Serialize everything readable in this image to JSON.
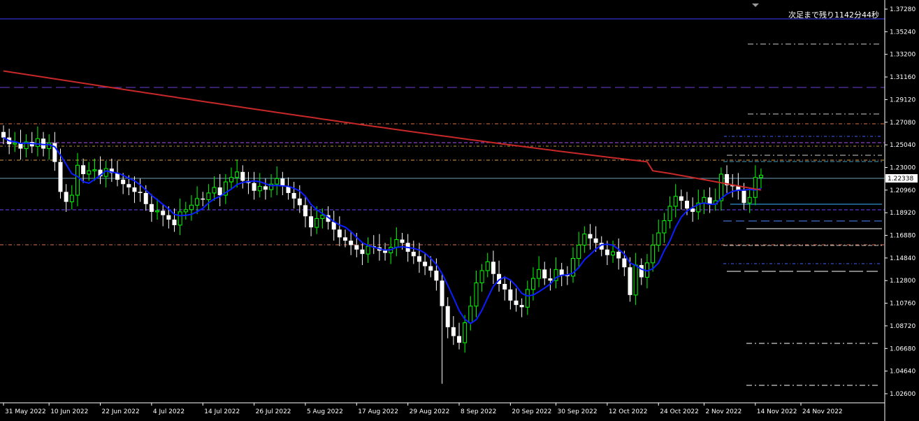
{
  "countdown_text": "次足まで残り1142分44秒",
  "current_price_label": "1.22338",
  "colors": {
    "background": "#000000",
    "bull_candle": "#00ff00",
    "bear_candle": "#ffffff",
    "ma_short": "#0a1eff",
    "ma_long": "#c82828",
    "axis": "#ffffff"
  },
  "chart_data": {
    "type": "candlestick",
    "timeframe": "daily",
    "instrument_note": "",
    "ylim": [
      1.024,
      1.374
    ],
    "y_ticks": [
      "1.37280",
      "1.35240",
      "1.33200",
      "1.31160",
      "1.29120",
      "1.27080",
      "1.25040",
      "1.23000",
      "1.20960",
      "1.18920",
      "1.16880",
      "1.14840",
      "1.12800",
      "1.10760",
      "1.08720",
      "1.06680",
      "1.04640",
      "1.02600"
    ],
    "x_ticks": [
      "31 May 2022",
      "10 Jun 2022",
      "22 Jun 2022",
      "4 Jul 2022",
      "14 Jul 2022",
      "26 Jul 2022",
      "5 Aug 2022",
      "17 Aug 2022",
      "29 Aug 2022",
      "8 Sep 2022",
      "20 Sep 2022",
      "30 Sep 2022",
      "12 Oct 2022",
      "24 Oct 2022",
      "2 Nov 2022",
      "14 Nov 2022",
      "24 Nov 2022"
    ],
    "x_tick_bar_index": [
      0,
      8,
      17,
      26,
      35,
      44,
      53,
      62,
      71,
      80,
      89,
      97,
      106,
      115,
      123,
      132,
      140
    ],
    "current_price": 1.22338,
    "closes": [
      1.257,
      1.251,
      1.252,
      1.247,
      1.253,
      1.249,
      1.256,
      1.247,
      1.252,
      1.235,
      1.208,
      1.199,
      1.205,
      1.232,
      1.224,
      1.227,
      1.228,
      1.222,
      1.229,
      1.225,
      1.219,
      1.215,
      1.212,
      1.208,
      1.207,
      1.197,
      1.19,
      1.191,
      1.187,
      1.183,
      1.178,
      1.19,
      1.192,
      1.196,
      1.202,
      1.201,
      1.207,
      1.212,
      1.205,
      1.217,
      1.221,
      1.226,
      1.218,
      1.216,
      1.209,
      1.213,
      1.21,
      1.215,
      1.22,
      1.213,
      1.207,
      1.202,
      1.196,
      1.186,
      1.176,
      1.184,
      1.187,
      1.181,
      1.174,
      1.167,
      1.164,
      1.16,
      1.156,
      1.152,
      1.159,
      1.158,
      1.155,
      1.153,
      1.158,
      1.165,
      1.162,
      1.154,
      1.15,
      1.145,
      1.141,
      1.137,
      1.128,
      1.105,
      1.086,
      1.078,
      1.072,
      1.09,
      1.105,
      1.126,
      1.137,
      1.145,
      1.134,
      1.125,
      1.12,
      1.11,
      1.106,
      1.104,
      1.12,
      1.13,
      1.138,
      1.13,
      1.128,
      1.138,
      1.133,
      1.132,
      1.148,
      1.16,
      1.17,
      1.166,
      1.162,
      1.156,
      1.151,
      1.154,
      1.148,
      1.14,
      1.115,
      1.142,
      1.131,
      1.144,
      1.16,
      1.171,
      1.182,
      1.195,
      1.204,
      1.2,
      1.193,
      1.19,
      1.198,
      1.203,
      1.197,
      1.2,
      1.224,
      1.214,
      1.213,
      1.209,
      1.198,
      1.203,
      1.221,
      1.223
    ]
  }
}
